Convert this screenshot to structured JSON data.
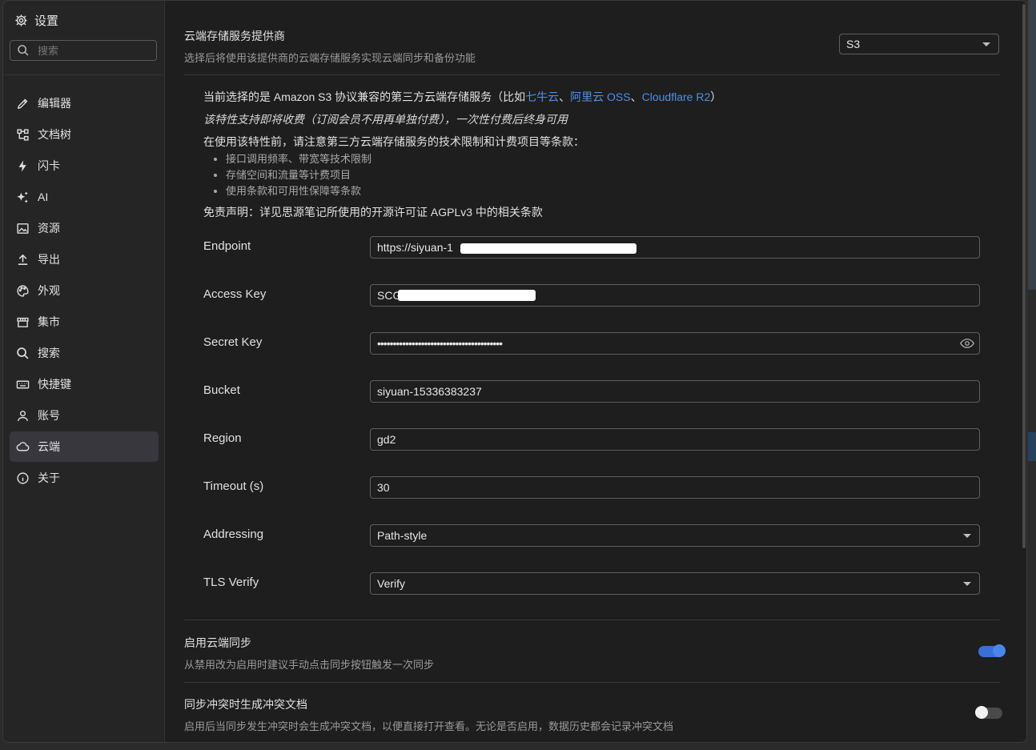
{
  "sidebar": {
    "title": "设置",
    "search_placeholder": "搜索",
    "items": [
      {
        "label": "编辑器",
        "icon": "pencil-icon"
      },
      {
        "label": "文档树",
        "icon": "tree-icon"
      },
      {
        "label": "闪卡",
        "icon": "lightning-icon"
      },
      {
        "label": "AI",
        "icon": "sparkle-icon"
      },
      {
        "label": "资源",
        "icon": "image-icon"
      },
      {
        "label": "导出",
        "icon": "upload-icon"
      },
      {
        "label": "外观",
        "icon": "palette-icon"
      },
      {
        "label": "集市",
        "icon": "store-icon"
      },
      {
        "label": "搜索",
        "icon": "search-icon"
      },
      {
        "label": "快捷键",
        "icon": "keyboard-icon"
      },
      {
        "label": "账号",
        "icon": "user-icon"
      },
      {
        "label": "云端",
        "icon": "cloud-icon"
      },
      {
        "label": "关于",
        "icon": "info-icon"
      }
    ],
    "active_index": 11
  },
  "provider": {
    "title": "云端存储服务提供商",
    "desc": "选择后将使用该提供商的云端存储服务实现云端同步和备份功能",
    "value": "S3"
  },
  "info": {
    "line1_prefix": "当前选择的是 Amazon S3 协议兼容的第三方云端存储服务（比如",
    "link1": "七牛云",
    "sep1": "、",
    "link2": "阿里云 OSS",
    "sep2": "、",
    "link3": "Cloudflare R2",
    "line1_suffix": "）",
    "line2": "该特性支持即将收费（订阅会员不用再单独付费），一次性付费后终身可用",
    "line3": "在使用该特性前，请注意第三方云端存储服务的技术限制和计费项目等条款：",
    "bullets": [
      "接口调用频率、带宽等技术限制",
      "存储空间和流量等计费项目",
      "使用条款和可用性保障等条款"
    ],
    "disclaimer": "免责声明：详见思源笔记所使用的开源许可证 AGPLv3 中的相关条款"
  },
  "form": {
    "endpoint": {
      "label": "Endpoint",
      "value": "https://siyuan-1"
    },
    "access_key": {
      "label": "Access Key",
      "value": "SCG"
    },
    "secret_key": {
      "label": "Secret Key",
      "value": "••••••••••••••••••••••••••••••••••••••••"
    },
    "bucket": {
      "label": "Bucket",
      "value": "siyuan-15336383237"
    },
    "region": {
      "label": "Region",
      "value": "gd2"
    },
    "timeout": {
      "label": "Timeout (s)",
      "value": "30"
    },
    "addressing": {
      "label": "Addressing",
      "value": "Path-style"
    },
    "tls_verify": {
      "label": "TLS Verify",
      "value": "Verify"
    }
  },
  "sync": {
    "title": "启用云端同步",
    "desc": "从禁用改为启用时建议手动点击同步按钮触发一次同步",
    "enabled": true
  },
  "conflict": {
    "title": "同步冲突时生成冲突文档",
    "desc": "启用后当同步发生冲突时会生成冲突文档，以便直接打开查看。无论是否启用，数据历史都会记录冲突文档",
    "enabled": false
  },
  "colors": {
    "accent": "#3a70d6",
    "link": "#4e8fe6"
  }
}
